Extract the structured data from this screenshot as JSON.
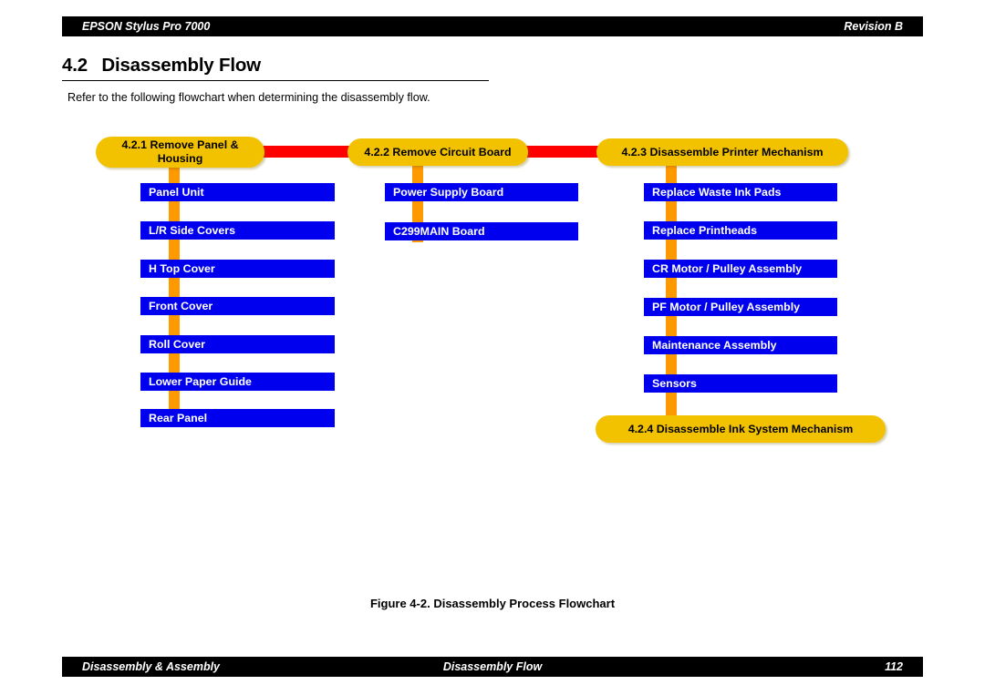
{
  "header": {
    "product": "EPSON Stylus Pro 7000",
    "revision": "Revision B"
  },
  "section": {
    "number": "4.2",
    "title": "Disassembly Flow",
    "intro": "Refer to the following flowchart when determining the disassembly flow."
  },
  "figure": {
    "caption": "Figure 4-2.  Disassembly Process Flowchart"
  },
  "footer": {
    "left": "Disassembly & Assembly",
    "center": "Disassembly Flow",
    "page": "112"
  },
  "colors": {
    "pill": "#F2C200",
    "step_box": "#0000EE",
    "spine": "#FF9900",
    "link": "#FF0000",
    "bar": "#000000",
    "step_text": "#FFFFFF",
    "pill_text": "#000000"
  },
  "flowchart": {
    "columns": [
      {
        "pill": "4.2.1 Remove Panel & Housing",
        "pill_lines": [
          "4.2.1 Remove Panel &",
          "Housing"
        ],
        "steps": [
          "Panel Unit",
          "L/R Side Covers",
          "H Top Cover",
          "Front Cover",
          "Roll Cover",
          "Lower Paper Guide",
          "Rear Panel"
        ]
      },
      {
        "pill": "4.2.2 Remove Circuit Board",
        "pill_lines": [
          "4.2.2 Remove Circuit Board"
        ],
        "steps": [
          "Power Supply Board",
          "C299MAIN Board"
        ]
      },
      {
        "pill": "4.2.3 Disassemble Printer Mechanism",
        "pill_lines": [
          "4.2.3 Disassemble Printer Mechanism"
        ],
        "steps": [
          "Replace Waste Ink Pads",
          "Replace Printheads",
          "CR Motor / Pulley Assembly",
          "PF Motor / Pulley Assembly",
          "Maintenance Assembly",
          "Sensors"
        ],
        "terminal_pill": "4.2.4 Disassemble Ink System Mechanism"
      }
    ]
  }
}
